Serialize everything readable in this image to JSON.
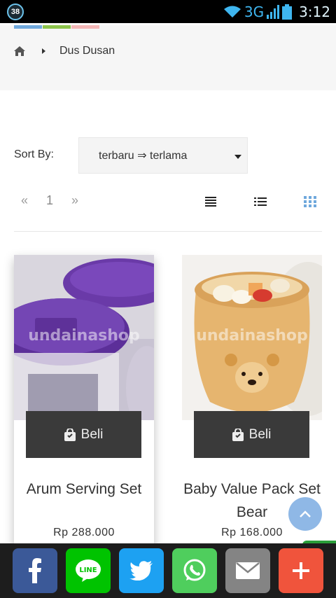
{
  "statusbar": {
    "notification_count": "38",
    "network": "3G",
    "time": "3:12"
  },
  "breadcrumb": {
    "home_icon": "home-icon",
    "current": "Dus Dusan"
  },
  "sort": {
    "label": "Sort By:",
    "selected": "terbaru ⇒ terlama"
  },
  "pagination": {
    "prev": "«",
    "page": "1",
    "next": "»"
  },
  "products": [
    {
      "name": "Arum Serving Set",
      "price": "Rp 288.000",
      "buy_label": "Beli",
      "watermark": "undainashop"
    },
    {
      "name": "Baby Value Pack Set Bear",
      "price": "Rp 168.000",
      "buy_label": "Beli",
      "watermark": "undainashop"
    }
  ],
  "share": [
    {
      "name": "facebook",
      "color": "#3b5998"
    },
    {
      "name": "line",
      "color": "#00c300"
    },
    {
      "name": "twitter",
      "color": "#1da1f2"
    },
    {
      "name": "whatsapp",
      "color": "#4fce5d"
    },
    {
      "name": "email",
      "color": "#848484"
    },
    {
      "name": "more",
      "color": "#f0543c"
    }
  ],
  "colors": {
    "strip1": "#6fa8dc",
    "strip2": "#8bc34a",
    "strip3": "#f4b6b6"
  }
}
